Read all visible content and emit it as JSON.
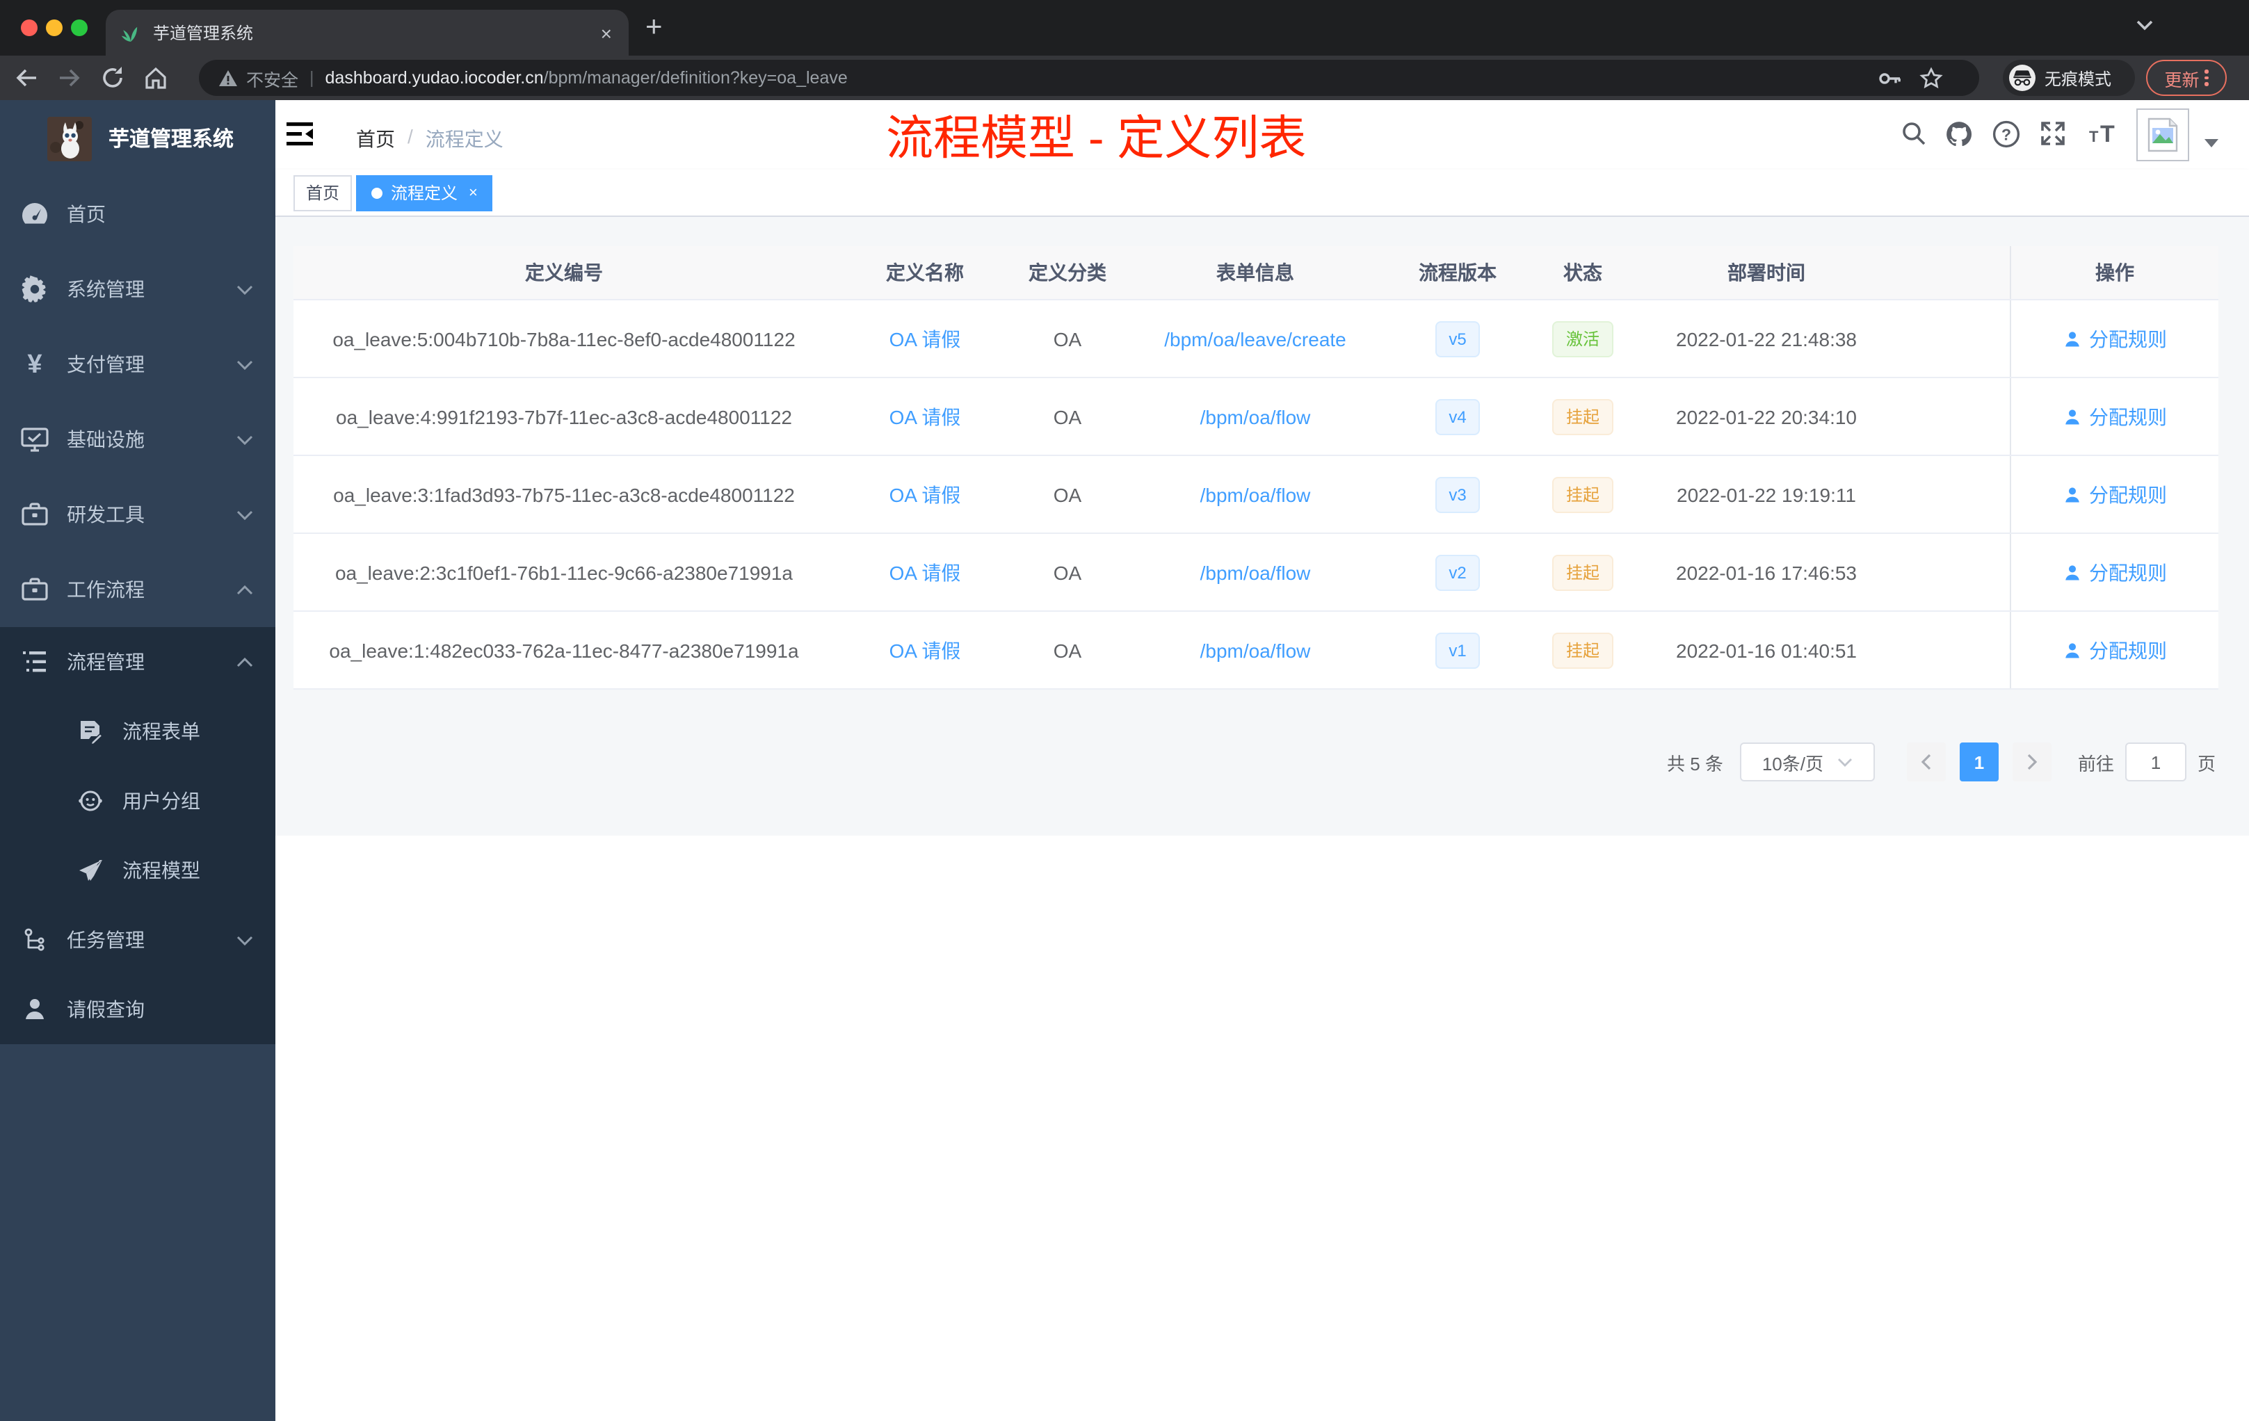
{
  "browser": {
    "tab": {
      "title": "芋道管理系统"
    },
    "address": {
      "security_label": "不安全",
      "host": "dashboard.yudao.iocoder.cn",
      "path": "/bpm/manager/definition?key=oa_leave"
    },
    "incognito_label": "无痕模式",
    "update_label": "更新"
  },
  "sidebar": {
    "logo_title": "芋道管理系统",
    "menu": [
      {
        "label": "首页",
        "icon": "dashboard-icon"
      },
      {
        "label": "系统管理",
        "icon": "gear-icon",
        "chevron": "down"
      },
      {
        "label": "支付管理",
        "icon": "yen-icon",
        "chevron": "down"
      },
      {
        "label": "基础设施",
        "icon": "monitor-icon",
        "chevron": "down"
      },
      {
        "label": "研发工具",
        "icon": "toolbox-icon",
        "chevron": "down"
      },
      {
        "label": "工作流程",
        "icon": "briefcase-icon",
        "chevron": "up"
      }
    ],
    "submenu": [
      {
        "label": "流程管理",
        "icon": "list-tree-icon",
        "chevron": "up"
      },
      {
        "label": "流程表单",
        "icon": "form-edit-icon"
      },
      {
        "label": "用户分组",
        "icon": "user-group-icon"
      },
      {
        "label": "流程模型",
        "icon": "paper-plane-icon"
      },
      {
        "label": "任务管理",
        "icon": "task-tree-icon",
        "chevron": "down"
      },
      {
        "label": "请假查询",
        "icon": "person-icon"
      }
    ]
  },
  "header": {
    "breadcrumb": [
      "首页",
      "流程定义"
    ],
    "breadcrumb_separator": "/",
    "annotation_title": "流程模型 - 定义列表"
  },
  "tags": [
    {
      "label": "首页",
      "active": false
    },
    {
      "label": "流程定义",
      "active": true,
      "close": "×"
    }
  ],
  "table": {
    "columns": [
      "定义编号",
      "定义名称",
      "定义分类",
      "表单信息",
      "流程版本",
      "状态",
      "部署时间",
      "操作"
    ],
    "rows": [
      {
        "id": "oa_leave:5:004b710b-7b8a-11ec-8ef0-acde48001122",
        "name": "OA 请假",
        "category": "OA",
        "form": "/bpm/oa/leave/create",
        "version": "v5",
        "status": "激活",
        "status_type": "success",
        "time": "2022-01-22 21:48:38",
        "action": "分配规则"
      },
      {
        "id": "oa_leave:4:991f2193-7b7f-11ec-a3c8-acde48001122",
        "name": "OA 请假",
        "category": "OA",
        "form": "/bpm/oa/flow",
        "version": "v4",
        "status": "挂起",
        "status_type": "warning",
        "time": "2022-01-22 20:34:10",
        "action": "分配规则"
      },
      {
        "id": "oa_leave:3:1fad3d93-7b75-11ec-a3c8-acde48001122",
        "name": "OA 请假",
        "category": "OA",
        "form": "/bpm/oa/flow",
        "version": "v3",
        "status": "挂起",
        "status_type": "warning",
        "time": "2022-01-22 19:19:11",
        "action": "分配规则"
      },
      {
        "id": "oa_leave:2:3c1f0ef1-76b1-11ec-9c66-a2380e71991a",
        "name": "OA 请假",
        "category": "OA",
        "form": "/bpm/oa/flow",
        "version": "v2",
        "status": "挂起",
        "status_type": "warning",
        "time": "2022-01-16 17:46:53",
        "action": "分配规则"
      },
      {
        "id": "oa_leave:1:482ec033-762a-11ec-8477-a2380e71991a",
        "name": "OA 请假",
        "category": "OA",
        "form": "/bpm/oa/flow",
        "version": "v1",
        "status": "挂起",
        "status_type": "warning",
        "time": "2022-01-16 01:40:51",
        "action": "分配规则"
      }
    ]
  },
  "pagination": {
    "total": "共 5 条",
    "page_size": "10条/页",
    "current_page": "1",
    "goto_label": "前往",
    "goto_value": "1",
    "page_unit": "页"
  },
  "colors": {
    "accent_blue": "#409eff",
    "success_green": "#67c23a",
    "warning_orange": "#e6a23c",
    "annotation_red": "#ff2600",
    "sidebar_bg": "#304156",
    "submenu_bg": "#1f2d3d"
  }
}
